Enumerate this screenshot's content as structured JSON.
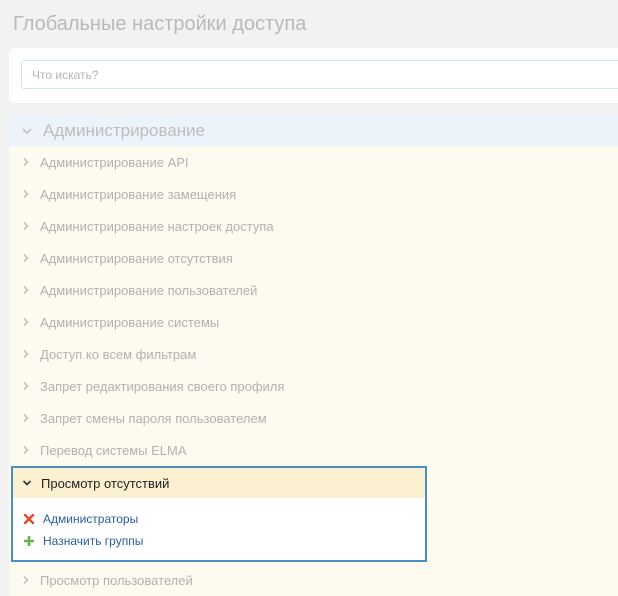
{
  "page": {
    "title": "Глобальные настройки доступа"
  },
  "search": {
    "placeholder": "Что искать?"
  },
  "group": {
    "title": "Администрирование",
    "expanded": true
  },
  "items": [
    {
      "label": "Администрирование API"
    },
    {
      "label": "Администрирование замещения"
    },
    {
      "label": "Администрирование настроек доступа"
    },
    {
      "label": "Администрирование отсутствия"
    },
    {
      "label": "Администрирование пользователей"
    },
    {
      "label": "Администрирование системы"
    },
    {
      "label": "Доступ ко всем фильтрам"
    },
    {
      "label": "Запрет редактирования своего профиля"
    },
    {
      "label": "Запрет смены пароля пользователем"
    },
    {
      "label": "Перевод системы ELMA"
    }
  ],
  "selected": {
    "label": "Просмотр отсутствий",
    "members": [
      {
        "label": "Администраторы",
        "icon": "remove-icon",
        "color": "#e04a2a"
      },
      {
        "label": "Назначить группы",
        "icon": "add-icon",
        "color": "#6ab04c"
      }
    ]
  },
  "after_items": [
    {
      "label": "Просмотр пользователей"
    }
  ],
  "colors": {
    "highlight_border": "#4a8fbf",
    "selected_row": "#fbf0cf",
    "list_background": "#fdfaf0",
    "group_background": "#edf3fb",
    "link": "#2a5d9f"
  }
}
